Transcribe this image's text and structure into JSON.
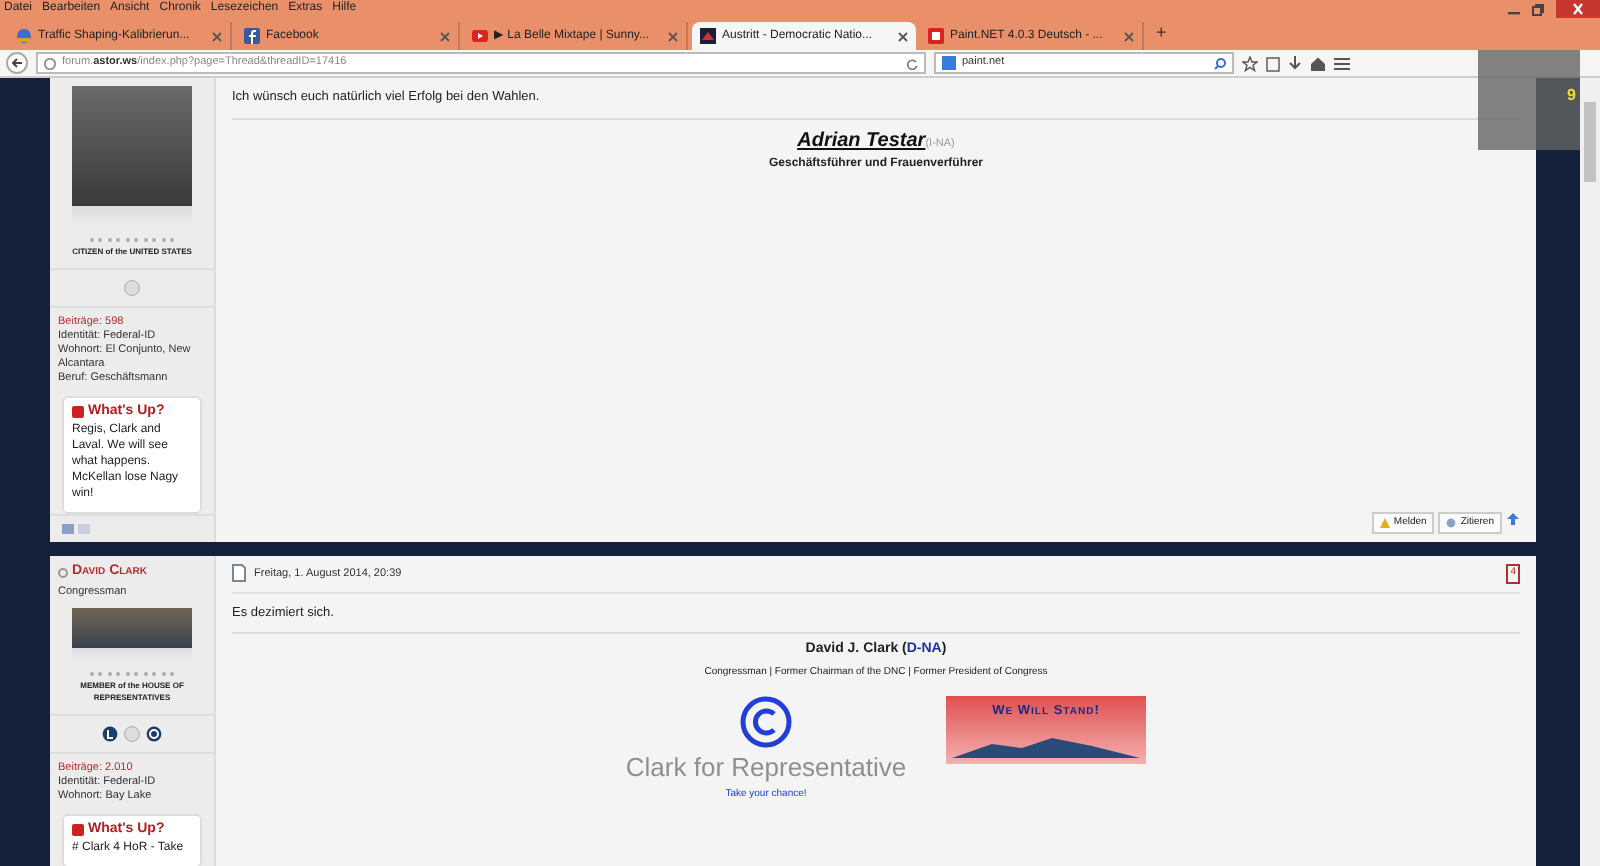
{
  "menu": [
    "Datei",
    "Bearbeiten",
    "Ansicht",
    "Chronik",
    "Lesezeichen",
    "Extras",
    "Hilfe"
  ],
  "tabs": [
    {
      "label": "Traffic Shaping-Kalibrierun...",
      "selected": false,
      "kind": "globe"
    },
    {
      "label": "Facebook",
      "selected": false,
      "kind": "facebook"
    },
    {
      "label": "▶ La Belle Mixtape | Sunny...",
      "selected": false,
      "kind": "video"
    },
    {
      "label": "Austritt - Democratic Natio...",
      "selected": true,
      "kind": "forum"
    },
    {
      "label": "Paint.NET 4.0.3 Deutsch - ...",
      "selected": false,
      "kind": "paint"
    }
  ],
  "new_tab": "+",
  "address": {
    "host_before": "forum.",
    "host_bold": "astor.ws",
    "rest": "/index.php?page=Thread&threadID=17416"
  },
  "search": {
    "value": "paint.net"
  },
  "overlay_widget": {
    "count": "9"
  },
  "posts": [
    {
      "badge": "CITIZEN of the UNITED STATES",
      "stats": [
        "Beiträge: 598",
        "Identität: Federal-ID",
        "Wohnort: El Conjunto, New Alcantara",
        "Beruf: Geschäftsmann"
      ],
      "whats_up_title": "What's Up?",
      "whats_up": "Regis, Clark and Laval. We will see what happens. McKellan lose Nagy win!",
      "text": "Ich wünsch euch natürlich viel Erfolg bei den Wahlen.",
      "signature": {
        "kind": "testar",
        "name": "Adrian Testar",
        "party": "(I-NA)",
        "subtitle": "Geschäftsführer und Frauenverführer"
      },
      "actions": [
        "Melden",
        "Zitieren"
      ]
    },
    {
      "author": "David Clark",
      "rank": "Congressman",
      "badge": "MEMBER of the HOUSE OF REPRESENTATIVES",
      "stats": [
        "Beiträge: 2.010",
        "Identität: Federal-ID",
        "Wohnort: Bay Lake"
      ],
      "whats_up_title": "What's Up?",
      "whats_up": "# Clark 4 HoR - Take",
      "date": "Freitag, 1. August 2014, 20:39",
      "number": "4",
      "text": "Es dezimiert sich.",
      "signature": {
        "kind": "clark",
        "name": "David J. Clark",
        "party_open": "(",
        "party": "D-NA",
        "party_close": ")",
        "subtitle": "Congressman | Former Chairman of the DNC | Former President of Congress",
        "logo_text": "Clark for Representative",
        "logo_link": "Take your chance!",
        "banner_text": "We Will Stand!"
      }
    }
  ]
}
